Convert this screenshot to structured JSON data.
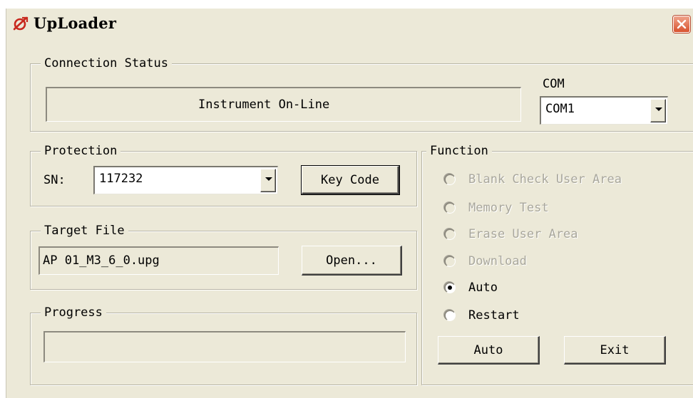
{
  "window": {
    "title": "UpLoader"
  },
  "connection": {
    "legend": "Connection Status",
    "status_text": "Instrument On-Line",
    "com_label": "COM",
    "com_value": "COM1"
  },
  "protection": {
    "legend": "Protection",
    "sn_label": "SN:",
    "sn_value": "117232",
    "key_code_label": "Key Code"
  },
  "target_file": {
    "legend": "Target File",
    "file_name": "AP 01_M3_6_0.upg",
    "open_label": "Open..."
  },
  "progress": {
    "legend": "Progress",
    "value": 0
  },
  "function": {
    "legend": "Function",
    "options": [
      {
        "label": "Blank Check User Area",
        "enabled": false,
        "selected": false
      },
      {
        "label": "Memory Test",
        "enabled": false,
        "selected": false
      },
      {
        "label": "Erase User Area",
        "enabled": false,
        "selected": false
      },
      {
        "label": "Download",
        "enabled": false,
        "selected": false
      },
      {
        "label": "Auto",
        "enabled": true,
        "selected": true
      },
      {
        "label": "Restart",
        "enabled": true,
        "selected": false
      }
    ],
    "action_label": "Auto",
    "exit_label": "Exit"
  },
  "colors": {
    "dialog_bg": "#ece9d8",
    "close_button": "#d8522e",
    "disabled_text": "#a9a79c"
  }
}
